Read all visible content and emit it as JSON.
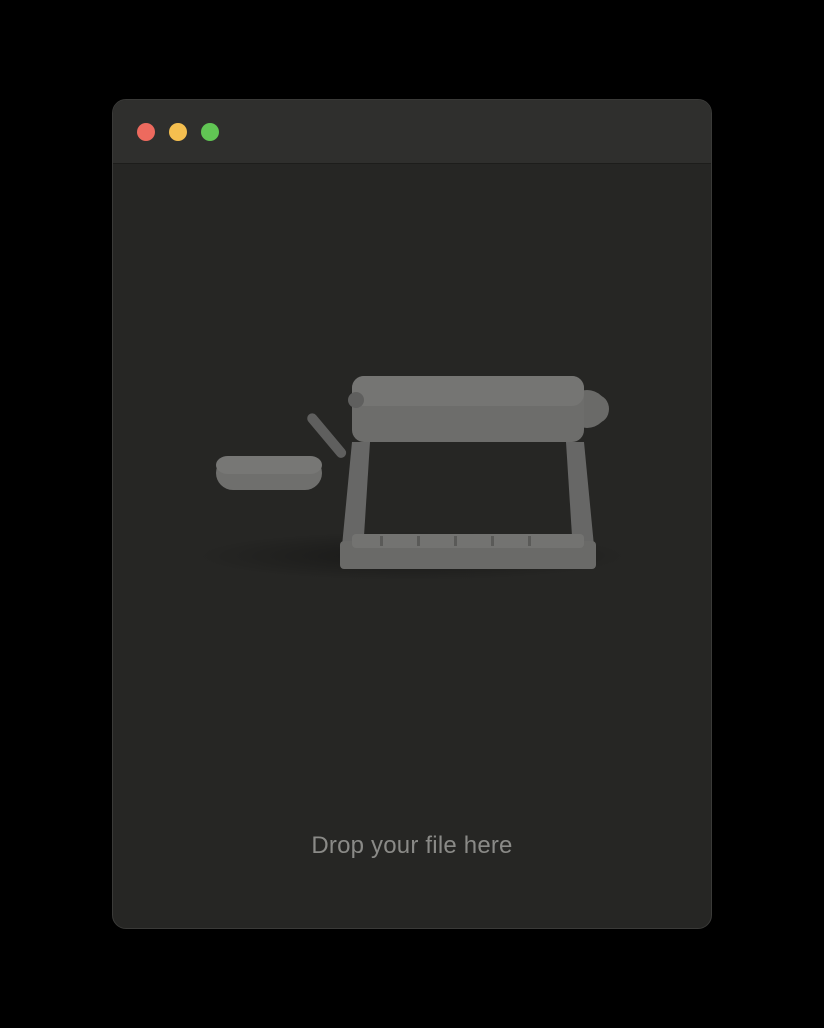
{
  "dropzone": {
    "prompt_text": "Drop your file here"
  },
  "icons": {
    "machine": "pasta-press-icon"
  },
  "colors": {
    "window_bg": "#262624",
    "titlebar_bg": "#2f2f2d",
    "machine_fill": "#676766",
    "machine_fill_light": "#727270",
    "prompt_text": "#8a8a87",
    "traffic_close": "#ed6a5e",
    "traffic_minimize": "#f5bf4f",
    "traffic_maximize": "#61c554"
  }
}
